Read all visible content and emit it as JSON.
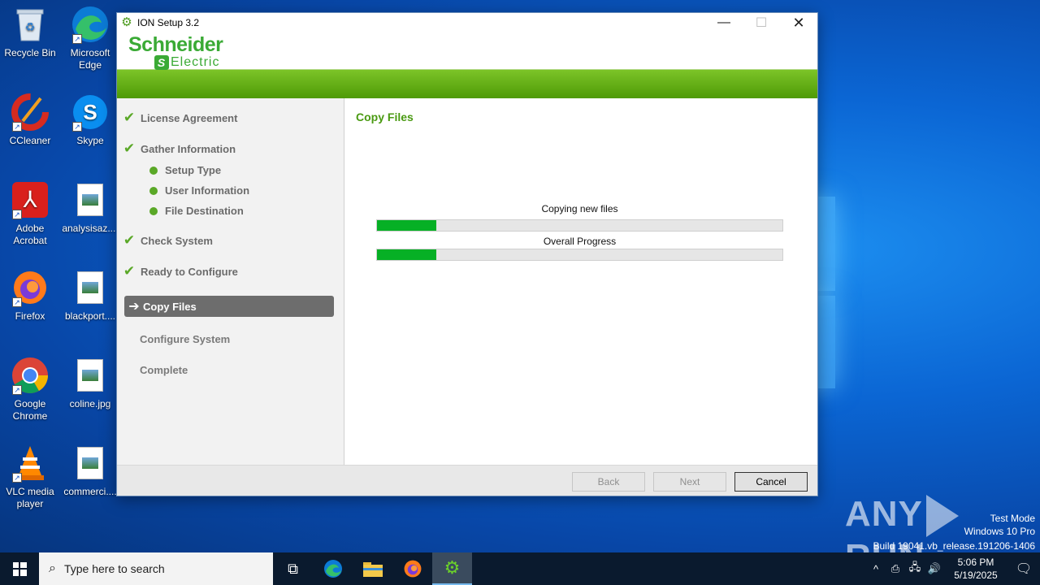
{
  "desktop": {
    "icons": [
      {
        "label": "Recycle Bin",
        "icon": "recycle-bin-icon"
      },
      {
        "label": "Microsoft Edge",
        "icon": "edge-icon"
      },
      {
        "label": "CCleaner",
        "icon": "ccleaner-icon"
      },
      {
        "label": "Skype",
        "icon": "skype-icon"
      },
      {
        "label": "Adobe Acrobat",
        "icon": "acrobat-icon"
      },
      {
        "label": "analysisaz....",
        "icon": "image-file-icon"
      },
      {
        "label": "Firefox",
        "icon": "firefox-icon"
      },
      {
        "label": "blackport....",
        "icon": "image-file-icon"
      },
      {
        "label": "Google Chrome",
        "icon": "chrome-icon"
      },
      {
        "label": "coline.jpg",
        "icon": "image-file-icon"
      },
      {
        "label": "VLC media player",
        "icon": "vlc-icon"
      },
      {
        "label": "commerci....",
        "icon": "image-file-icon"
      }
    ]
  },
  "window": {
    "title": "ION Setup 3.2",
    "logo_line1": "Schneider",
    "logo_line2": "Electric",
    "controls": {
      "minimize": "—",
      "maximize": "☐",
      "close": "✕"
    }
  },
  "steps": {
    "license": "License Agreement",
    "gather": "Gather Information",
    "setup_type": "Setup Type",
    "user_info": "User Information",
    "file_dest": "File Destination",
    "check_system": "Check System",
    "ready": "Ready to Configure",
    "copy_files": "Copy Files",
    "configure": "Configure System",
    "complete": "Complete"
  },
  "main": {
    "heading": "Copy Files",
    "progress1_label": "Copying new files",
    "progress1_value": 0.146,
    "progress2_label": "Overall Progress",
    "progress2_value": 0.146
  },
  "footer": {
    "back": "Back",
    "next": "Next",
    "cancel": "Cancel"
  },
  "watermark": {
    "brand_left": "ANY",
    "brand_right": "RUN",
    "line1": "Test Mode",
    "line2": "Windows 10 Pro",
    "line3": "Build 19041.vb_release.191206-1406"
  },
  "taskbar": {
    "search_placeholder": "Type here to search",
    "time": "5:06 PM",
    "date": "5/19/2025"
  },
  "colors": {
    "accent_green": "#5aa827",
    "progress_green": "#06b025",
    "band_green": "#6bb51c"
  }
}
